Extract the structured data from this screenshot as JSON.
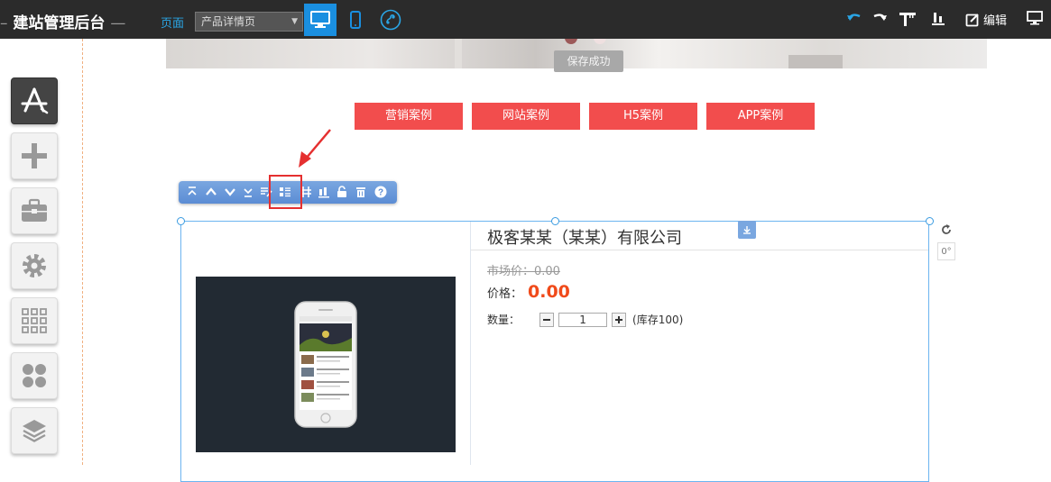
{
  "topbar": {
    "brand_left_dash": "–",
    "brand_title": "建站管理后台",
    "brand_right_dash": "—",
    "page_label": "页面",
    "page_select_value": "产品详情页",
    "edit_label": "编辑"
  },
  "banner": {
    "save_toast": "保存成功"
  },
  "case_buttons": [
    "营销案例",
    "网站案例",
    "H5案例",
    "APP案例"
  ],
  "product": {
    "title": "极客某某（某某）有限公司",
    "market_price": "市场价：0.00",
    "price_label": "价格：",
    "price_value": "0.00",
    "qty_label": "数量：",
    "qty_value": "1",
    "stock": "(库存100)"
  },
  "side_controls": {
    "rotate_value": "0°"
  },
  "colors": {
    "accent_red": "#f24d4d",
    "price_orange": "#f04a1a",
    "device_active": "#1a8fe0",
    "toolbar_blue": "#5b8cd4",
    "topbar_bg": "#2b2b2b"
  },
  "icons": {
    "desktop": "desktop-icon",
    "mobile": "mobile-icon",
    "miniprogram": "mini-program-icon",
    "undo": "undo-icon",
    "redo": "redo-icon",
    "ruler": "ruler-icon",
    "chart": "bar-chart-icon",
    "edit": "edit-icon",
    "preview": "monitor-icon"
  }
}
